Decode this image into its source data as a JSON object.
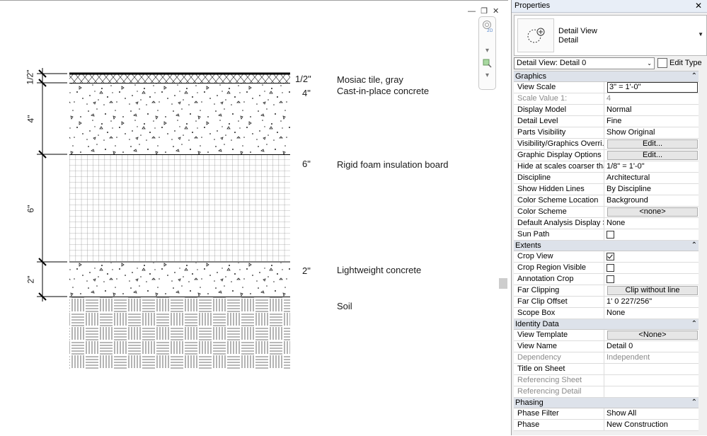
{
  "window_controls": {
    "minimize": "—",
    "restore": "❐",
    "close": "✕"
  },
  "canvas": {
    "layers": [
      {
        "name": "Mosiac tile, gray",
        "thickness": "1/2\"",
        "pattern": "cross-hatch"
      },
      {
        "name": "Cast-in-place concrete",
        "thickness": "4\"",
        "pattern": "concrete"
      },
      {
        "name": "Rigid foam insulation board",
        "thickness": "6\"",
        "pattern": "grid"
      },
      {
        "name": "Lightweight concrete",
        "thickness": "2\"",
        "pattern": "concrete"
      },
      {
        "name": "Soil",
        "thickness": "",
        "pattern": "parquet"
      }
    ],
    "dimensions": [
      "1/2\"",
      "4\"",
      "6\"",
      "2\""
    ]
  },
  "properties": {
    "title": "Properties",
    "close_icon": "close-icon",
    "type_family": "Detail View",
    "type_name": "Detail",
    "instance_select": "Detail View: Detail 0",
    "edit_type_label": "Edit Type",
    "groups": [
      {
        "label": "Graphics",
        "rows": [
          {
            "name": "View Scale",
            "value": "3\" = 1'-0\"",
            "kind": "edit"
          },
          {
            "name": "Scale Value    1:",
            "value": "4",
            "kind": "disabled"
          },
          {
            "name": "Display Model",
            "value": "Normal",
            "kind": "text"
          },
          {
            "name": "Detail Level",
            "value": "Fine",
            "kind": "text"
          },
          {
            "name": "Parts Visibility",
            "value": "Show Original",
            "kind": "text"
          },
          {
            "name": "Visibility/Graphics Overri...",
            "value": "Edit...",
            "kind": "button"
          },
          {
            "name": "Graphic Display Options",
            "value": "Edit...",
            "kind": "button"
          },
          {
            "name": "Hide at scales coarser than",
            "value": "1/8\" = 1'-0\"",
            "kind": "text"
          },
          {
            "name": "Discipline",
            "value": "Architectural",
            "kind": "text"
          },
          {
            "name": "Show Hidden Lines",
            "value": "By Discipline",
            "kind": "text"
          },
          {
            "name": "Color Scheme Location",
            "value": "Background",
            "kind": "text"
          },
          {
            "name": "Color Scheme",
            "value": "<none>",
            "kind": "button"
          },
          {
            "name": "Default Analysis Display S...",
            "value": "None",
            "kind": "text"
          },
          {
            "name": "Sun Path",
            "value": "",
            "kind": "checkbox",
            "checked": false
          }
        ]
      },
      {
        "label": "Extents",
        "rows": [
          {
            "name": "Crop View",
            "value": "",
            "kind": "checkbox",
            "checked": true
          },
          {
            "name": "Crop Region Visible",
            "value": "",
            "kind": "checkbox",
            "checked": false
          },
          {
            "name": "Annotation Crop",
            "value": "",
            "kind": "checkbox",
            "checked": false
          },
          {
            "name": "Far Clipping",
            "value": "Clip without line",
            "kind": "button"
          },
          {
            "name": "Far Clip Offset",
            "value": "1'  0 227/256\"",
            "kind": "text"
          },
          {
            "name": "Scope Box",
            "value": "None",
            "kind": "text"
          }
        ]
      },
      {
        "label": "Identity Data",
        "rows": [
          {
            "name": "View Template",
            "value": "<None>",
            "kind": "button"
          },
          {
            "name": "View Name",
            "value": "Detail 0",
            "kind": "text"
          },
          {
            "name": "Dependency",
            "value": "Independent",
            "kind": "disabled"
          },
          {
            "name": "Title on Sheet",
            "value": "",
            "kind": "text"
          },
          {
            "name": "Referencing Sheet",
            "value": "",
            "kind": "disabled"
          },
          {
            "name": "Referencing Detail",
            "value": "",
            "kind": "disabled"
          }
        ]
      },
      {
        "label": "Phasing",
        "rows": [
          {
            "name": "Phase Filter",
            "value": "Show All",
            "kind": "text"
          },
          {
            "name": "Phase",
            "value": "New Construction",
            "kind": "text"
          }
        ]
      }
    ]
  }
}
